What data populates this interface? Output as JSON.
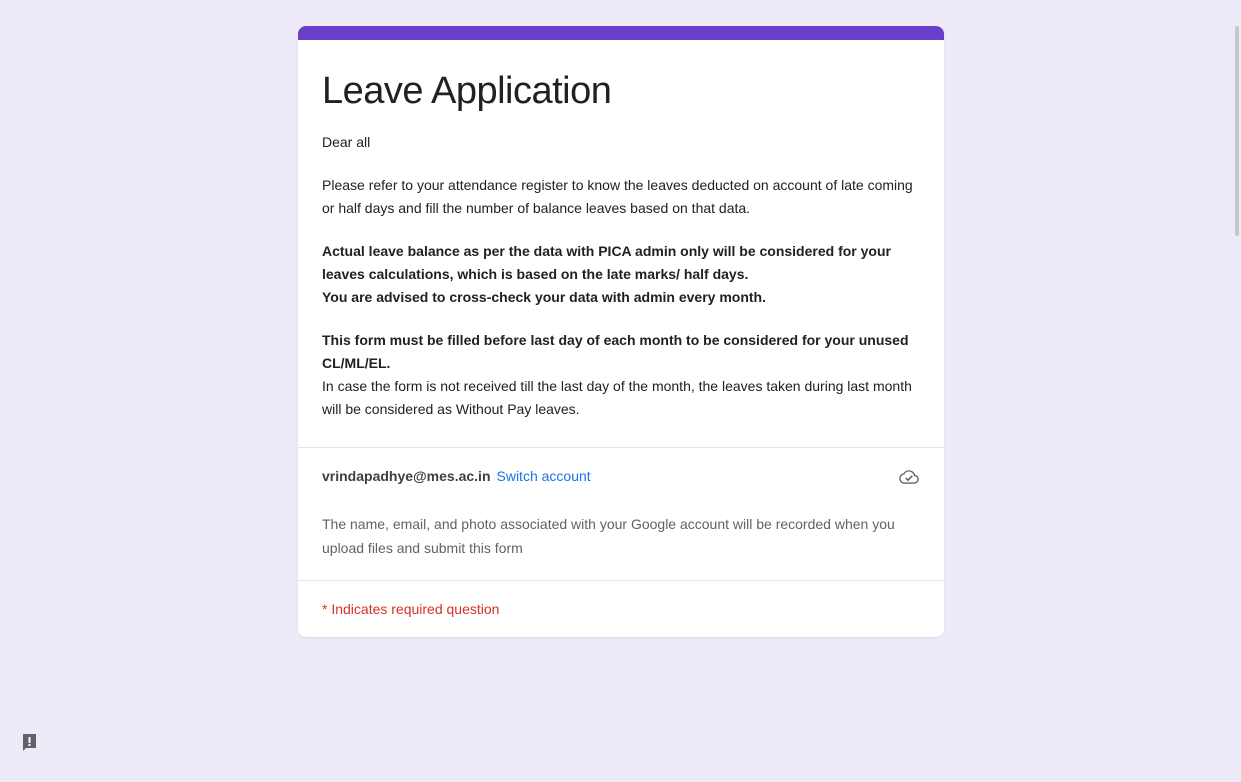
{
  "form": {
    "title": "Leave Application",
    "greeting": "Dear all",
    "para1": "Please refer to your attendance register to know the leaves deducted on account of late coming or half days and fill the number of balance leaves based on that data.",
    "para2_line1": "Actual leave balance as per the data with PICA admin only will be considered for your leaves calculations, which is based on the late marks/ half days.",
    "para2_line2": "You are advised to cross-check your data with admin every month.",
    "para3_bold": "This form must be filled before last day of each month to be considered for your unused CL/ML/EL.",
    "para3_normal": "In case the form is not received till the last day of the month, the leaves taken during last month will be considered as Without Pay leaves."
  },
  "account": {
    "email": "vrindapadhye@mes.ac.in",
    "switch_label": "Switch account",
    "privacy_note": "The name, email, and photo associated with your Google account will be recorded when you upload files and submit this form"
  },
  "required_note": "* Indicates required question",
  "colors": {
    "accent": "#6a3fc8",
    "background": "#efeaf7",
    "link": "#1a73e8",
    "required": "#d93025"
  }
}
